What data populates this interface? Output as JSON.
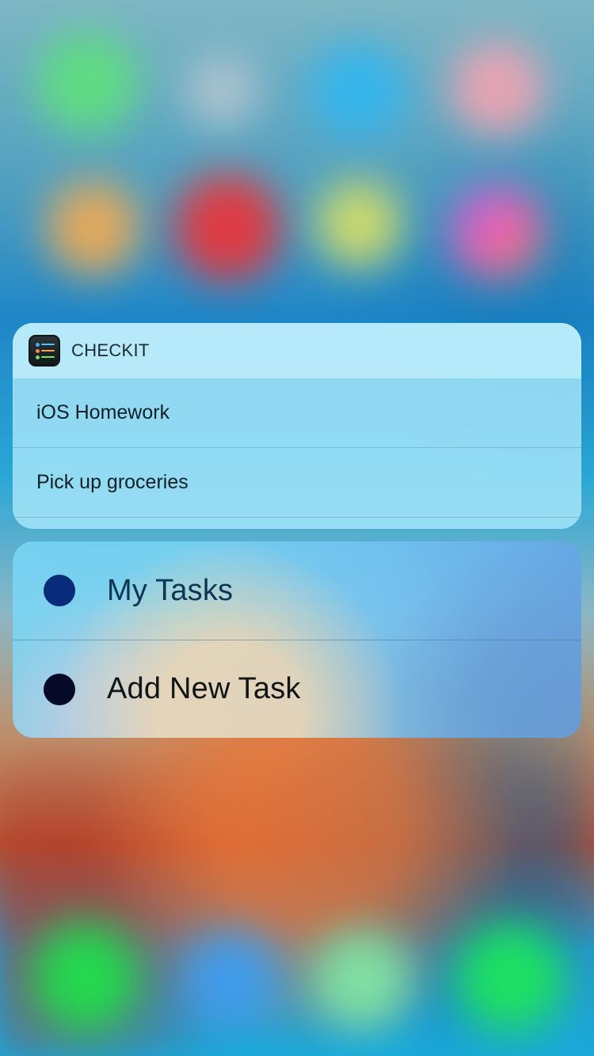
{
  "app": {
    "name": "CHECKIT"
  },
  "widget": {
    "tasks": [
      {
        "label": "iOS Homework"
      },
      {
        "label": "Pick up groceries"
      }
    ]
  },
  "quick_actions": [
    {
      "label": "My Tasks",
      "dot_color": "#082b7a",
      "text_color": "#0c3654"
    },
    {
      "label": "Add New Task",
      "dot_color": "#050a28",
      "text_color": "#101417"
    }
  ],
  "theme": {
    "widget_header_bg": "#bee9f8",
    "widget_body_bg": "#a6e5f9",
    "action_sheet_left": "#7ad6f6",
    "action_sheet_right": "#67a6e6"
  }
}
